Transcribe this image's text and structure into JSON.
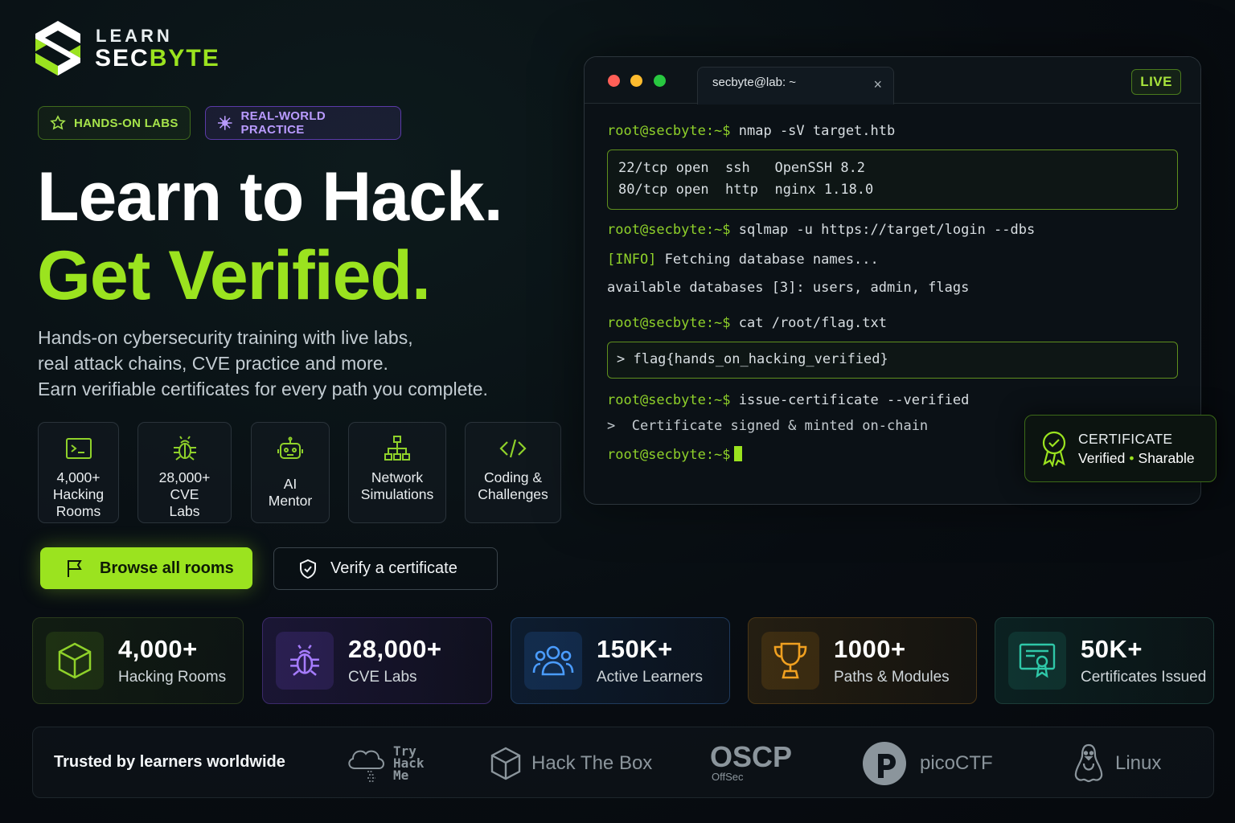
{
  "logo": {
    "line1": "LEARN",
    "brand_a": "SEC",
    "brand_b": "BYTE"
  },
  "tags": [
    {
      "label": "HANDS-ON LABS",
      "icon": "flask-icon"
    },
    {
      "label": "REAL-WORLD PRACTICE",
      "icon": "sparkle-icon"
    }
  ],
  "headline": {
    "line1": "Learn to Hack.",
    "line2": "Get Verified."
  },
  "description": [
    "Hands-on cybersecurity training with live labs,",
    "real attack chains, CVE practice and more.",
    "Earn verifiable certificates for every path you complete."
  ],
  "features": [
    {
      "label": "4,000+\nHacking\nRooms",
      "icon": "terminal-icon"
    },
    {
      "label": "28,000+\nCVE\nLabs",
      "icon": "bug-icon"
    },
    {
      "label": "AI\nMentor",
      "icon": "robot-icon"
    },
    {
      "label": "Network\nSimulations",
      "icon": "network-icon"
    },
    {
      "label": "Coding &\nChallenges",
      "icon": "code-icon"
    }
  ],
  "buttons": {
    "primary": "Browse all rooms",
    "secondary": "Verify a certificate"
  },
  "terminal": {
    "tab_title": "secbyte@lab: ~",
    "live_badge": "LIVE",
    "prompt": "root@secbyte:~$",
    "cmd1": " nmap -sV target.htb",
    "out1a": "22/tcp open  ssh   OpenSSH 8.2",
    "out1b": "80/tcp open  http  nginx 1.18.0",
    "cmd2": " sqlmap -u https://target/login --dbs",
    "info_tag": "[INFO]",
    "info_text": " Fetching database names...",
    "dbs": "available databases [3]: users, admin, flags",
    "cmd3": " cat /root/flag.txt",
    "flag": "> flag{hands_on_hacking_verified}",
    "cmd4": " issue-certificate --verified",
    "signed": ">  Certificate signed & minted on-chain"
  },
  "certificate": {
    "title": "CERTIFICATE",
    "verified": "Verified",
    "dot": "•",
    "sharable": "Sharable"
  },
  "stats": [
    {
      "value": "4,000+",
      "label": "Hacking Rooms",
      "icon": "cube-icon",
      "color": "#8fd12a"
    },
    {
      "value": "28,000+",
      "label": "CVE Labs",
      "icon": "bug-icon",
      "color": "#a67cff"
    },
    {
      "value": "150K+",
      "label": "Active Learners",
      "icon": "users-icon",
      "color": "#4a9cff"
    },
    {
      "value": "1000+",
      "label": "Paths & Modules",
      "icon": "trophy-icon",
      "color": "#f0a020"
    },
    {
      "value": "50K+",
      "label": "Certificates Issued",
      "icon": "certificate-icon",
      "color": "#2fc7a8"
    }
  ],
  "trusted": {
    "label": "Trusted by learners worldwide",
    "brands": [
      {
        "name": "Try\nHack\nMe",
        "icon": "cloud-icon"
      },
      {
        "name": "Hack The Box",
        "icon": "box-icon"
      },
      {
        "name": "OSCP",
        "sub": "OffSec"
      },
      {
        "name": "picoCTF",
        "icon": "pico-icon"
      },
      {
        "name": "Linux",
        "icon": "tux-icon"
      }
    ]
  }
}
